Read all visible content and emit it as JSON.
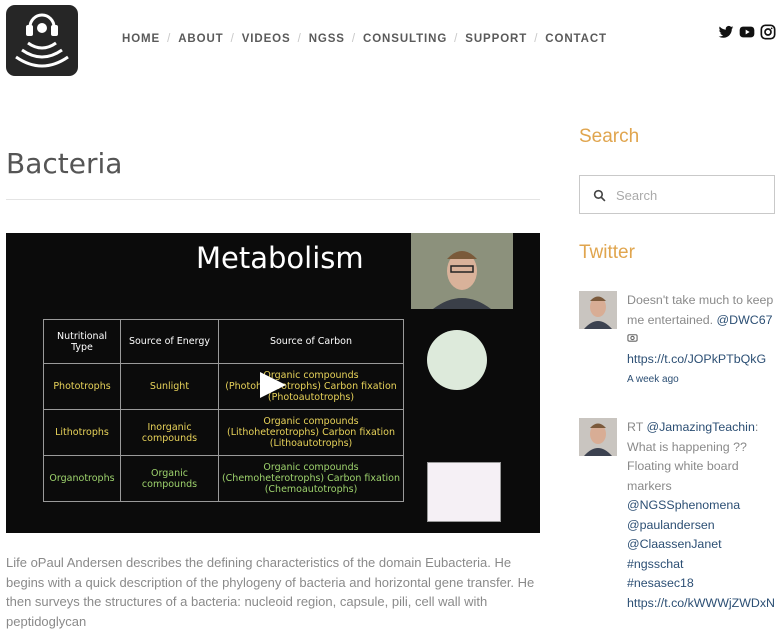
{
  "nav": {
    "items": [
      "HOME",
      "ABOUT",
      "VIDEOS",
      "NGSS",
      "CONSULTING",
      "SUPPORT",
      "CONTACT"
    ],
    "separator": "/"
  },
  "social": [
    "twitter-icon",
    "youtube-icon",
    "instagram-icon"
  ],
  "page": {
    "title": "Bacteria",
    "description": "Life oPaul Andersen describes the defining characteristics of the domain Eubacteria. He begins with a quick description of the phylogeny of bacteria and horizontal gene transfer. He then surveys the structures of a bacteria: nucleoid region, capsule, pili, cell wall with peptidoglycan"
  },
  "video": {
    "slide_title": "Metabolism",
    "headers": [
      "Nutritional Type",
      "Source of Energy",
      "Source of Carbon"
    ],
    "rows": [
      [
        "Phototrophs",
        "Sunlight",
        "Organic compounds (Photoheterotrophs) Carbon fixation (Photoautotrophs)"
      ],
      [
        "Lithotrophs",
        "Inorganic compounds",
        "Organic compounds (Lithoheterotrophs) Carbon fixation (Lithoautotrophs)"
      ],
      [
        "Organotrophs",
        "Organic compounds",
        "Organic compounds (Chemoheterotrophs) Carbon fixation (Chemoautotrophs)"
      ]
    ]
  },
  "sidebar": {
    "search_heading": "Search",
    "search_placeholder": "Search",
    "twitter_heading": "Twitter",
    "tweets": [
      {
        "text": "Doesn't take much to keep me entertained. ",
        "mention": "@DWC67",
        "link": "https://t.co/JOPkPTbQkG",
        "time": "A week ago"
      },
      {
        "prefix": "RT ",
        "mention": "@JamazingTeachin",
        "text": ": What is happening ?? Floating white board markers",
        "mentions": [
          "@NGSSphenomena",
          "@paulandersen",
          "@ClaassenJanet",
          "#ngsschat",
          "#nesasec18"
        ],
        "link": "https://t.co/kWWWjZWDxN"
      }
    ]
  },
  "colors": {
    "accent": "#e0a54e",
    "link": "#2c4f74",
    "text": "#8a8a8a"
  }
}
